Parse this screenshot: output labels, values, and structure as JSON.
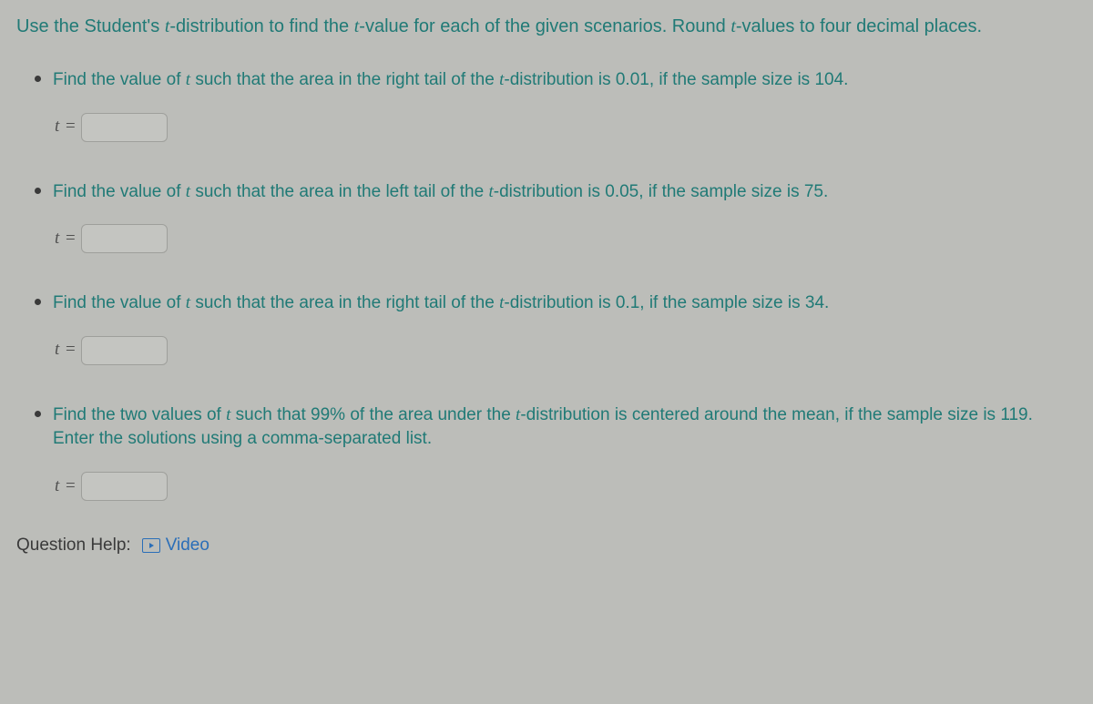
{
  "intro": {
    "p1": "Use the Student's ",
    "t1": "t",
    "p2": "-distribution to find the ",
    "t2": "t",
    "p3": "-value for each of the given scenarios. Round ",
    "t3": "t",
    "p4": "-values to four decimal places."
  },
  "items": [
    {
      "a": "Find the value of ",
      "t1": "t",
      "b": " such that the area in the right tail of the ",
      "t2": "t",
      "c": "-distribution is 0.01, if the sample size is 104.",
      "label_t": "t",
      "label_eq": " ="
    },
    {
      "a": "Find the value of ",
      "t1": "t",
      "b": " such that the area in the left tail of the ",
      "t2": "t",
      "c": "-distribution is 0.05, if the sample size is 75.",
      "label_t": "t",
      "label_eq": " ="
    },
    {
      "a": "Find the value of ",
      "t1": "t",
      "b": " such that the area in the right tail of the ",
      "t2": "t",
      "c": "-distribution is 0.1, if the sample size is 34.",
      "label_t": "t",
      "label_eq": " ="
    },
    {
      "a": "Find the two values of ",
      "t1": "t",
      "b": " such that 99% of the area under the ",
      "t2": "t",
      "c": "-distribution is centered around the mean, if the sample size is 119. Enter the solutions using a comma-separated list.",
      "label_t": "t",
      "label_eq": " ="
    }
  ],
  "help": {
    "label": "Question Help:",
    "video": "Video"
  }
}
